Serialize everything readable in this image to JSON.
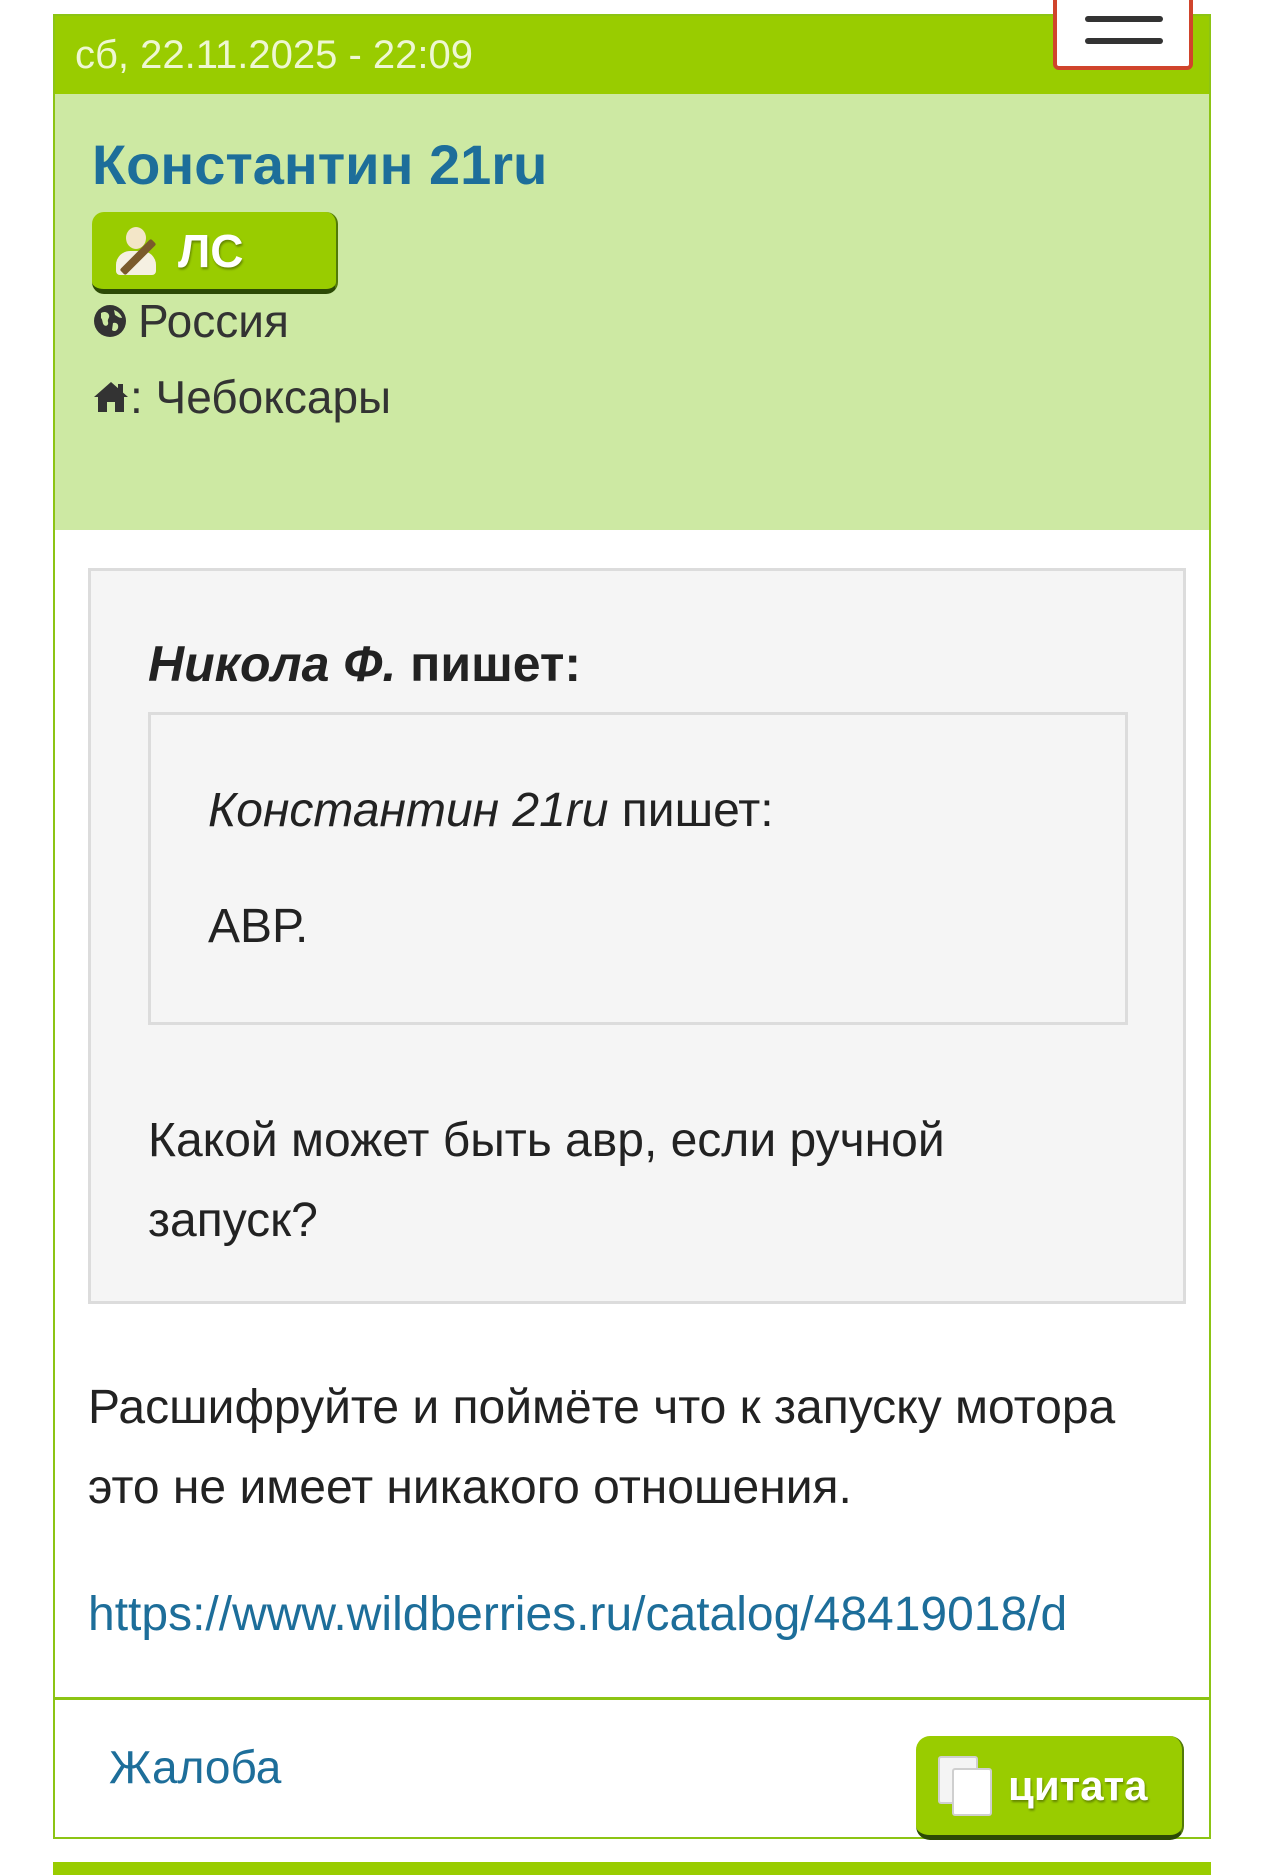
{
  "post": {
    "date": "сб, 22.11.2025 - 22:09",
    "author": {
      "name": "Константин 21ru",
      "pm_label": "ЛС",
      "country": "Россия",
      "city": ": Чебоксары"
    },
    "outer_quote": {
      "author": "Никола Ф.",
      "writes": " пишет:",
      "inner_quote": {
        "author": "Константин 21ru",
        "writes": " пишет:",
        "text": "АВР."
      },
      "text": "Какой может быть авр, если ручной запуск?"
    },
    "reply_text": "Расшифруйте и поймёте что к запуску мотора это не имеет никакого отношения.",
    "link_text": "https://www.wildberries.ru/catalog/48419018/d",
    "footer": {
      "report_label": "Жалоба",
      "quote_label": "цитата"
    }
  },
  "icons": {
    "menu": "hamburger-menu-icon",
    "pm": "user-pen-icon",
    "country": "globe-icon",
    "city": "home-icon",
    "quote": "copy-icon"
  },
  "colors": {
    "header_green": "#99cc00",
    "author_bg": "#cde9a3",
    "link_blue": "#1d6e9a",
    "menu_border": "#d0442b"
  }
}
